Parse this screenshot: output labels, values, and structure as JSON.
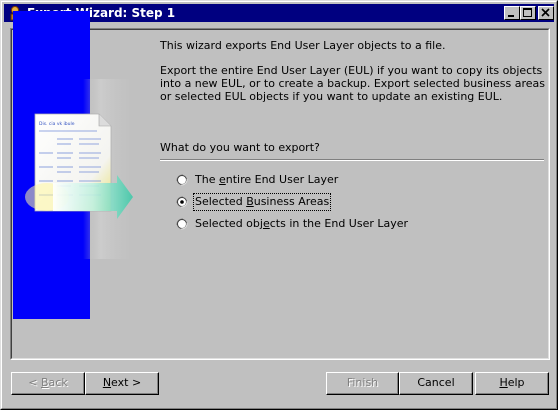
{
  "window": {
    "title": "Export Wizard: Step 1",
    "titlebar_color": "#000080",
    "controls": [
      "minimize-icon",
      "maximize-icon",
      "close-icon"
    ]
  },
  "graphic": {
    "document_label": "Dis. cia vk ibule",
    "blue_band_color": "#0000ff"
  },
  "intro": {
    "line1": "This wizard exports End User Layer objects to a file.",
    "line2": "Export the entire End User Layer (EUL) if you want to copy its objects into a new EUL, or to create a backup. Export selected business areas or selected EUL objects if you want to update an existing EUL."
  },
  "question": "What do you want to export?",
  "options": [
    {
      "pre": "The ",
      "key": "e",
      "post": "ntire End User Layer",
      "selected": false
    },
    {
      "pre": "Selected ",
      "key": "B",
      "post": "usiness Areas",
      "selected": true
    },
    {
      "pre": "Selected obj",
      "key": "e",
      "post": "cts in the End User Layer",
      "selected": false
    }
  ],
  "buttons": {
    "back": {
      "pre": "< ",
      "key": "B",
      "post": "ack",
      "enabled": false
    },
    "next": {
      "pre": "",
      "key": "N",
      "post": "ext >",
      "enabled": true
    },
    "finish": {
      "pre": "",
      "key": "",
      "post": "Finish",
      "enabled": false
    },
    "cancel": {
      "pre": "",
      "key": "",
      "post": "Cancel",
      "enabled": true
    },
    "help": {
      "pre": "",
      "key": "H",
      "post": "elp",
      "enabled": true
    }
  }
}
